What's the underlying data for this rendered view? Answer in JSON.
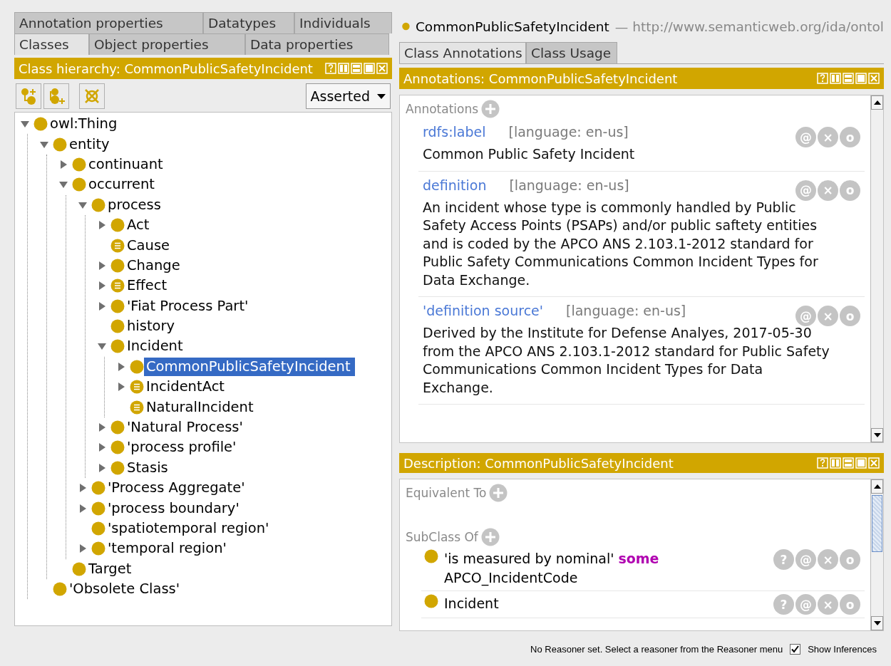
{
  "left_tabs": [
    [
      {
        "label": "Annotation properties",
        "selected": false
      },
      {
        "label": "Datatypes",
        "selected": false
      },
      {
        "label": "Individuals",
        "selected": false
      }
    ],
    [
      {
        "label": "Classes",
        "selected": true
      },
      {
        "label": "Object properties",
        "selected": false
      },
      {
        "label": "Data properties",
        "selected": false
      }
    ]
  ],
  "class_hierarchy": {
    "title": "Class hierarchy: CommonPublicSafetyIncident",
    "mode": "Asserted",
    "tree": [
      {
        "label": "owl:Thing",
        "kind": "primitive",
        "selected": false,
        "expanded": true,
        "children": [
          {
            "label": "entity",
            "kind": "primitive",
            "selected": false,
            "expanded": true,
            "children": [
              {
                "label": "continuant",
                "kind": "primitive",
                "selected": false,
                "expanded": false
              },
              {
                "label": "occurrent",
                "kind": "primitive",
                "selected": false,
                "expanded": true,
                "children": [
                  {
                    "label": "process",
                    "kind": "primitive",
                    "selected": false,
                    "expanded": true,
                    "children": [
                      {
                        "label": "Act",
                        "kind": "primitive",
                        "selected": false,
                        "expanded": false
                      },
                      {
                        "label": "Cause",
                        "kind": "defined",
                        "selected": false
                      },
                      {
                        "label": "Change",
                        "kind": "primitive",
                        "selected": false,
                        "expanded": false
                      },
                      {
                        "label": "Effect",
                        "kind": "defined",
                        "selected": false,
                        "expanded": false
                      },
                      {
                        "label": "'Fiat Process Part'",
                        "kind": "primitive",
                        "selected": false,
                        "expanded": false
                      },
                      {
                        "label": "history",
                        "kind": "primitive",
                        "selected": false
                      },
                      {
                        "label": "Incident",
                        "kind": "primitive",
                        "selected": false,
                        "expanded": true,
                        "children": [
                          {
                            "label": "CommonPublicSafetyIncident",
                            "kind": "primitive",
                            "selected": true,
                            "expanded": false
                          },
                          {
                            "label": "IncidentAct",
                            "kind": "defined",
                            "selected": false,
                            "expanded": false
                          },
                          {
                            "label": "NaturalIncident",
                            "kind": "defined",
                            "selected": false
                          }
                        ]
                      },
                      {
                        "label": "'Natural Process'",
                        "kind": "primitive",
                        "selected": false,
                        "expanded": false
                      },
                      {
                        "label": "'process profile'",
                        "kind": "primitive",
                        "selected": false,
                        "expanded": false
                      },
                      {
                        "label": "Stasis",
                        "kind": "primitive",
                        "selected": false,
                        "expanded": false
                      }
                    ]
                  },
                  {
                    "label": "'Process Aggregate'",
                    "kind": "primitive",
                    "selected": false,
                    "expanded": false
                  },
                  {
                    "label": "'process boundary'",
                    "kind": "primitive",
                    "selected": false,
                    "expanded": false
                  },
                  {
                    "label": "'spatiotemporal region'",
                    "kind": "primitive",
                    "selected": false
                  },
                  {
                    "label": "'temporal region'",
                    "kind": "primitive",
                    "selected": false,
                    "expanded": false
                  }
                ]
              },
              {
                "label": "Target",
                "kind": "primitive",
                "selected": false
              }
            ]
          },
          {
            "label": "'Obsolete Class'",
            "kind": "primitive",
            "selected": false
          }
        ]
      }
    ]
  },
  "entity": {
    "name": "CommonPublicSafetyIncident",
    "iri": "— http://www.semanticweb.org/ida/ontol"
  },
  "right_tabs": [
    {
      "label": "Class Annotations",
      "selected": true
    },
    {
      "label": "Class Usage",
      "selected": false
    }
  ],
  "annotations_panel": {
    "title": "Annotations: CommonPublicSafetyIncident",
    "section": "Annotations",
    "items": [
      {
        "property": "rdfs:label",
        "language": "[language: en-us]",
        "value": "Common Public Safety Incident",
        "actions": [
          "@",
          "×",
          "o"
        ]
      },
      {
        "property": "definition",
        "language": "[language: en-us]",
        "value": "An incident whose type is commonly handled by Public Safety Access Points (PSAPs) and/or public saftety entities and is coded by the APCO ANS 2.103.1-2012 standard for Public Safety Communications Common Incident Types for Data Exchange.",
        "actions": [
          "@",
          "×",
          "o"
        ]
      },
      {
        "property": "'definition source'",
        "language": "[language: en-us]",
        "value": "Derived  by the Institute for Defense Analyes, 2017-05-30 from the APCO ANS 2.103.1-2012 standard for Public Safety Communications Common Incident Types for Data Exchange.",
        "actions": [
          "@",
          "×",
          "o"
        ]
      }
    ]
  },
  "description_panel": {
    "title": "Description: CommonPublicSafetyIncident",
    "sections": [
      {
        "label": "Equivalent To"
      },
      {
        "label": "SubClass Of",
        "items": [
          {
            "text": "'is measured by nominal' **some** APCO_IncidentCode",
            "actions": [
              "?",
              "@",
              "×",
              "o"
            ]
          },
          {
            "text": "Incident",
            "actions": [
              "?",
              "@",
              "×",
              "o"
            ]
          }
        ]
      }
    ]
  },
  "status_bar": {
    "message": "No Reasoner set. Select a reasoner from the Reasoner menu",
    "show_inferences": {
      "label": "Show Inferences",
      "checked": true
    }
  }
}
